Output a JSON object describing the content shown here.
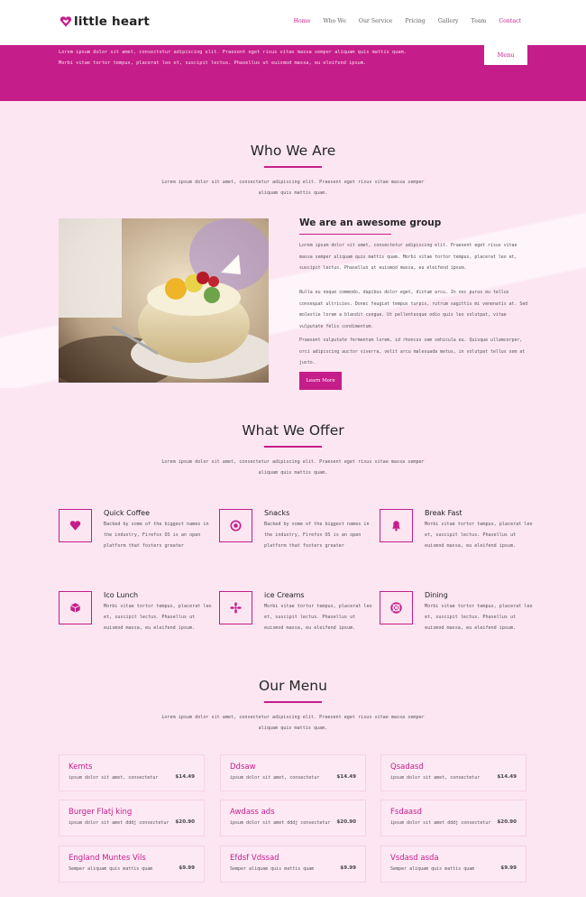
{
  "brand": {
    "name": "little heart",
    "accent": "#c51d8a"
  },
  "nav": [
    {
      "label": "Home",
      "active": true
    },
    {
      "label": "Who We",
      "active": false
    },
    {
      "label": "Our Service",
      "active": false
    },
    {
      "label": "Pricing",
      "active": false
    },
    {
      "label": "Gallery",
      "active": false
    },
    {
      "label": "Team",
      "active": false
    },
    {
      "label": "Contact",
      "active": false
    }
  ],
  "banner": {
    "line1": "Lorem ipsum dolor sit amet, consectetur adipiscing elit. Praesent eget risus vitae massa semper aliquam quis mattis quam.",
    "line2": "Morbi vitae tortor tempus, placerat leo et, suscipit lectus. Phasellus ut euismod massa, eu eleifend ipsum.",
    "menu_button": "Menu"
  },
  "who": {
    "title": "Who We Are",
    "desc": "Lorem ipsum dolor sit amet, consectetur adipiscing elit. Praesent eget risus vitae massa semper aliquam quis mattis quam.",
    "heading": "We are an awesome group",
    "p1": "Lorem ipsum dolor sit amet, consectetur adipiscing elit. Praesent eget risus vitae massa semper aliquam quis mattis quam. Morbi vitae tortor tempus, placerat leo et, suscipit lectus. Phasellus ut euismod massa, eu eleifend ipsum.",
    "p2": "Nulla eu neque commodo, dapibus dolor eget, dictum arcu. In nec purus eu tellus consequat ultricies. Donec feugiat tempus turpis, rutrum sagittis mi venenatis at. Sed molestie lorem a blandit congue. Ut pellentesque odio quis leo volutpat, vitae vulputate felis condimentum.",
    "p3": "Praesent vulputate fermentum lorem, id rhoncus sem vehicula eu. Quisque ullamcorper, orci adipiscing auctor viverra, velit arcu malesuada metus, in volutpat tellus sem at justo.",
    "button": "Learn More"
  },
  "offer": {
    "title": "What We Offer",
    "desc": "Lorem ipsum dolor sit amet, consectetur adipiscing elit. Praesent eget risus vitae massa semper aliquam quis mattis quam.",
    "items": [
      {
        "title": "Quick Coffee",
        "desc": "Backed by some of the biggest names in the industry, Firefox OS is an open platform that fosters greater",
        "icon": "heart-icon"
      },
      {
        "title": "Snacks",
        "desc": "Backed by some of the biggest names in the industry, Firefox OS is an open platform that fosters greater",
        "icon": "target-icon"
      },
      {
        "title": "Break Fast",
        "desc": "Morbi vitae tortor tempus, placerat leo et, suscipit lectus. Phasellus ut euismod massa, eu eleifend ipsum.",
        "icon": "bell-icon"
      },
      {
        "title": "Ico Lunch",
        "desc": "Morbi vitae tortor tempus, placerat leo et, suscipit lectus. Phasellus ut euismod massa, eu eleifend ipsum.",
        "icon": "cube-icon"
      },
      {
        "title": "ice Creams",
        "desc": "Morbi vitae tortor tempus, placerat leo et, suscipit lectus. Phasellus ut euismod massa, eu eleifend ipsum.",
        "icon": "flower-icon"
      },
      {
        "title": "Dining",
        "desc": "Morbi vitae tortor tempus, placerat leo et, suscipit lectus. Phasellus ut euismod massa, eu eleifend ipsum.",
        "icon": "lifebuoy-icon"
      }
    ]
  },
  "menu": {
    "title": "Our Menu",
    "desc": "Lorem ipsum dolor sit amet, consectetur adipiscing elit. Praesent eget risus vitae massa semper aliquam quis mattis quam.",
    "items": [
      {
        "name": "Kemts",
        "desc": "ipsum dolor sit amet, consectetur",
        "price": "$14.49"
      },
      {
        "name": "Ddsaw",
        "desc": "ipsum dolor sit amet, consectetur",
        "price": "$14.49"
      },
      {
        "name": "Qsadasd",
        "desc": "ipsum dolor sit amet, consectetur",
        "price": "$14.49"
      },
      {
        "name": "Burger Flatj king",
        "desc": "ipsum dolor sit amet dddj consectetur",
        "price": "$20.90"
      },
      {
        "name": "Awdass ads",
        "desc": "ipsum dolor sit amet dddj consectetur",
        "price": "$20.90"
      },
      {
        "name": "Fsdaasd",
        "desc": "ipsum dolor sit amet dddj consectetur",
        "price": "$20.90"
      },
      {
        "name": "England Muntes Vils",
        "desc": "Semper aliquam quis mattis quam",
        "price": "$9.99"
      },
      {
        "name": "Efdsf Vdssad",
        "desc": "Semper aliquam quis mattis quam",
        "price": "$9.99"
      },
      {
        "name": "Vsdasd asda",
        "desc": "Semper aliquam quis mattis quam",
        "price": "$9.99"
      }
    ]
  }
}
